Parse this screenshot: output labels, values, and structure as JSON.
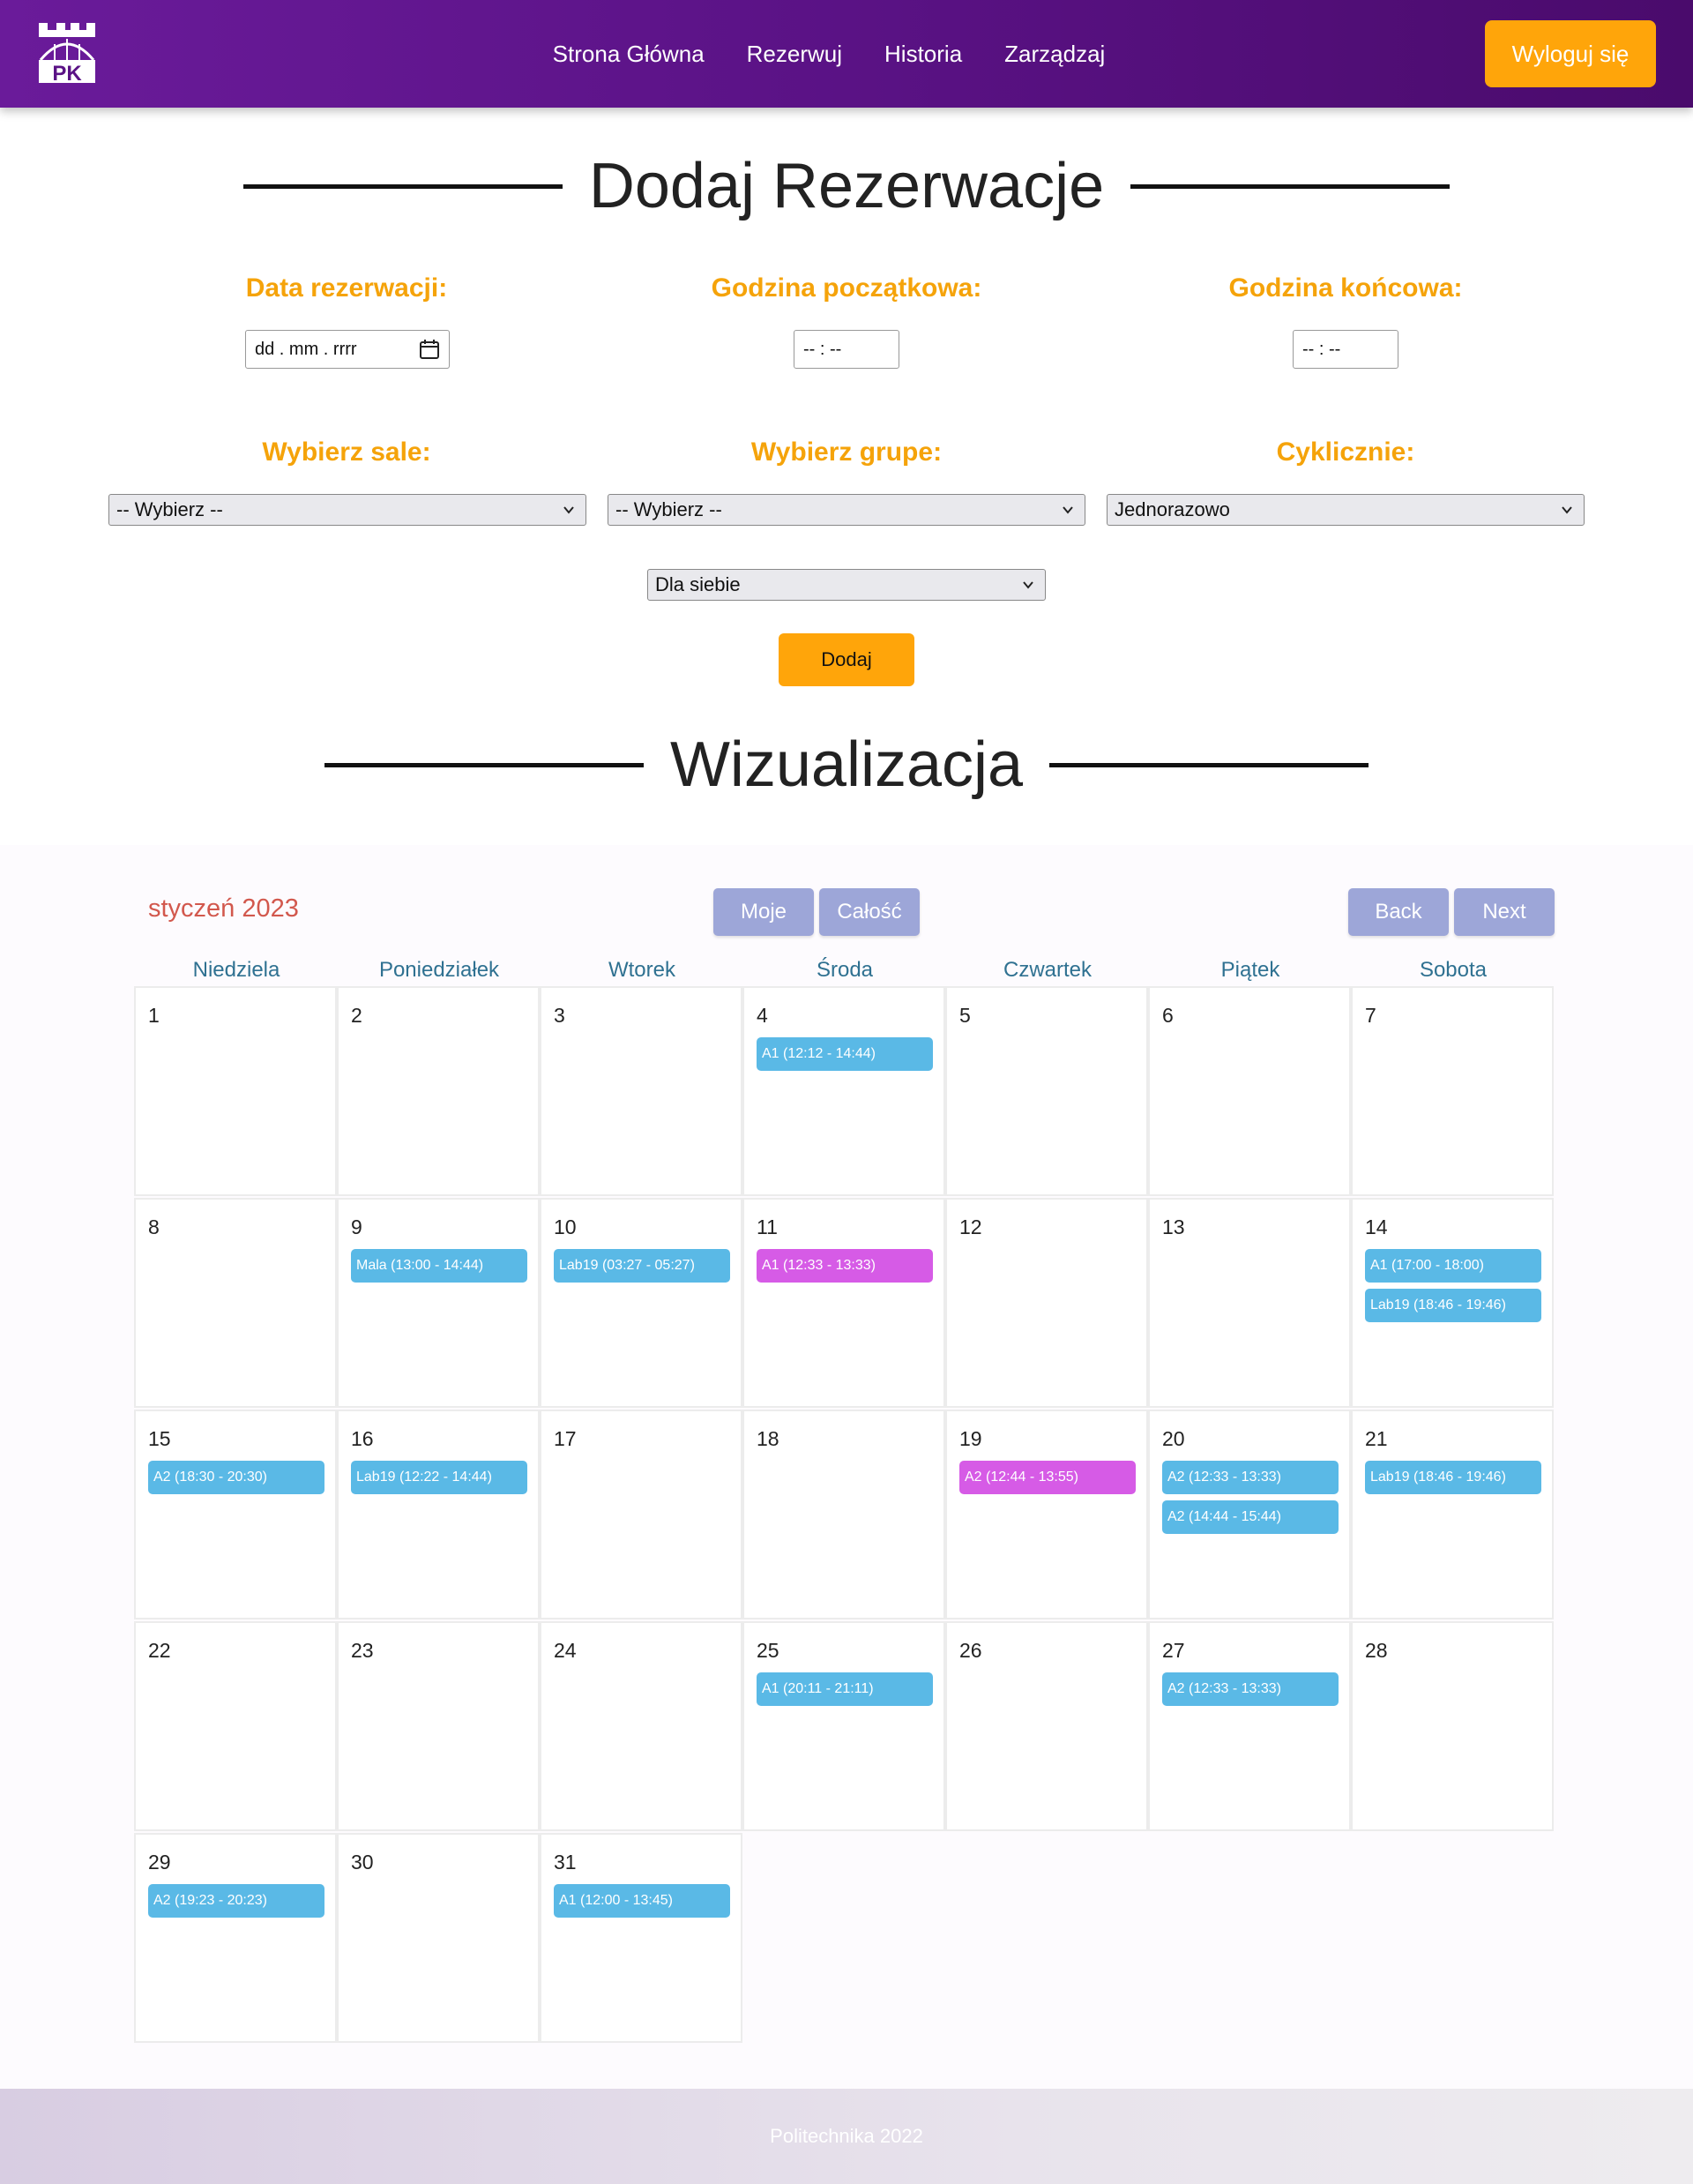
{
  "nav": {
    "links": [
      "Strona Główna",
      "Rezerwuj",
      "Historia",
      "Zarządzaj"
    ],
    "logout": "Wyloguj się",
    "logo_text": "PK"
  },
  "form": {
    "title": "Dodaj Rezerwacje",
    "date_label": "Data rezerwacji:",
    "date_value": "dd . mm . rrrr",
    "start_label": "Godzina początkowa:",
    "start_value": "-- : --",
    "end_label": "Godzina końcowa:",
    "end_value": "-- : --",
    "room_label": "Wybierz sale:",
    "room_value": "-- Wybierz --",
    "group_label": "Wybierz grupe:",
    "group_value": "-- Wybierz --",
    "cyclic_label": "Cyklicznie:",
    "cyclic_value": "Jednorazowo",
    "for_value": "Dla siebie",
    "submit": "Dodaj"
  },
  "viz": {
    "title": "Wizualizacja",
    "month": "styczeń 2023",
    "mine": "Moje",
    "all": "Całość",
    "back": "Back",
    "next": "Next",
    "weekdays": [
      "Niedziela",
      "Poniedziałek",
      "Wtorek",
      "Środa",
      "Czwartek",
      "Piątek",
      "Sobota"
    ]
  },
  "calendar": {
    "days": [
      {
        "num": "1",
        "events": []
      },
      {
        "num": "2",
        "events": []
      },
      {
        "num": "3",
        "events": []
      },
      {
        "num": "4",
        "events": [
          {
            "label": "A1 (12:12 - 14:44)",
            "color": "blue"
          }
        ]
      },
      {
        "num": "5",
        "events": []
      },
      {
        "num": "6",
        "events": []
      },
      {
        "num": "7",
        "events": []
      },
      {
        "num": "8",
        "events": []
      },
      {
        "num": "9",
        "events": [
          {
            "label": "Mala (13:00 - 14:44)",
            "color": "blue"
          }
        ]
      },
      {
        "num": "10",
        "events": [
          {
            "label": "Lab19 (03:27 - 05:27)",
            "color": "blue"
          }
        ]
      },
      {
        "num": "11",
        "events": [
          {
            "label": "A1 (12:33 - 13:33)",
            "color": "purple"
          }
        ]
      },
      {
        "num": "12",
        "events": []
      },
      {
        "num": "13",
        "events": []
      },
      {
        "num": "14",
        "events": [
          {
            "label": "A1 (17:00 - 18:00)",
            "color": "blue"
          },
          {
            "label": "Lab19 (18:46 - 19:46)",
            "color": "blue"
          }
        ]
      },
      {
        "num": "15",
        "events": [
          {
            "label": "A2 (18:30 - 20:30)",
            "color": "blue"
          }
        ]
      },
      {
        "num": "16",
        "events": [
          {
            "label": "Lab19 (12:22 - 14:44)",
            "color": "blue"
          }
        ]
      },
      {
        "num": "17",
        "events": []
      },
      {
        "num": "18",
        "events": []
      },
      {
        "num": "19",
        "events": [
          {
            "label": "A2 (12:44 - 13:55)",
            "color": "purple"
          }
        ]
      },
      {
        "num": "20",
        "events": [
          {
            "label": "A2 (12:33 - 13:33)",
            "color": "blue"
          },
          {
            "label": "A2 (14:44 - 15:44)",
            "color": "blue"
          }
        ]
      },
      {
        "num": "21",
        "events": [
          {
            "label": "Lab19 (18:46 - 19:46)",
            "color": "blue"
          }
        ]
      },
      {
        "num": "22",
        "events": []
      },
      {
        "num": "23",
        "events": []
      },
      {
        "num": "24",
        "events": []
      },
      {
        "num": "25",
        "events": [
          {
            "label": "A1 (20:11 - 21:11)",
            "color": "blue"
          }
        ]
      },
      {
        "num": "26",
        "events": []
      },
      {
        "num": "27",
        "events": [
          {
            "label": "A2 (12:33 - 13:33)",
            "color": "blue"
          }
        ]
      },
      {
        "num": "28",
        "events": []
      },
      {
        "num": "29",
        "events": [
          {
            "label": "A2 (19:23 - 20:23)",
            "color": "blue"
          }
        ]
      },
      {
        "num": "30",
        "events": []
      },
      {
        "num": "31",
        "events": [
          {
            "label": "A1 (12:00 - 13:45)",
            "color": "blue"
          }
        ]
      }
    ]
  },
  "footer": {
    "text": "Politechnika 2022"
  }
}
